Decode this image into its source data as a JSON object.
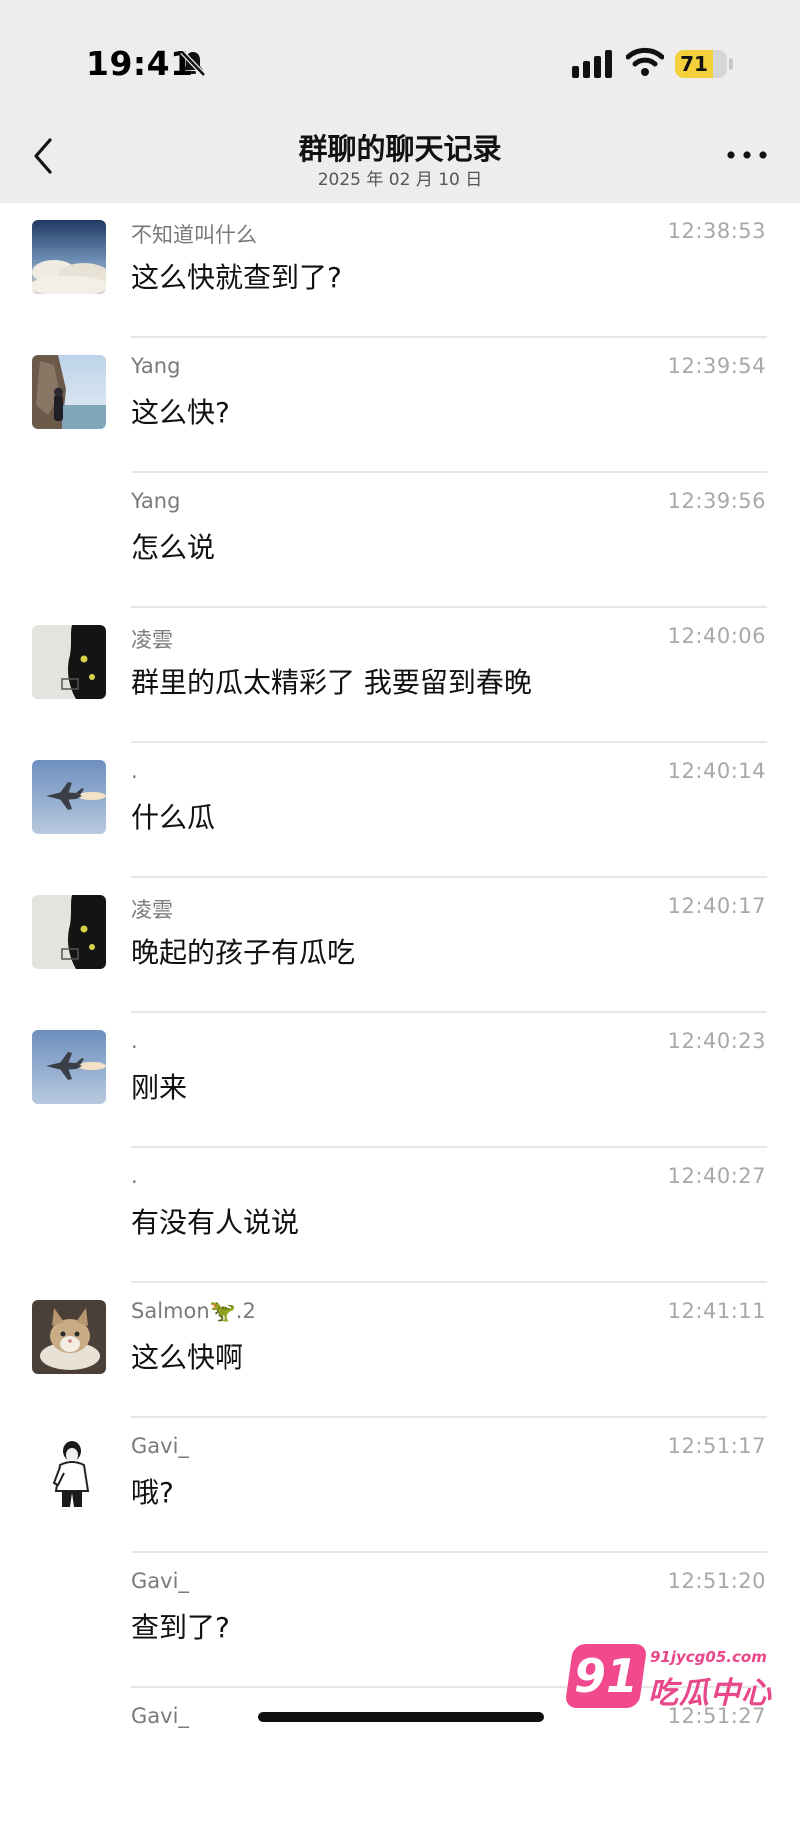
{
  "status_bar": {
    "time": "19:41",
    "battery": "71",
    "icons": [
      "bell-slash-icon",
      "signal-bars-icon",
      "wifi-icon",
      "battery-icon"
    ]
  },
  "nav": {
    "title": "群聊的聊天记录",
    "subtitle": "2025 年 02 月 10 日",
    "back_icon": "chevron-left-icon",
    "more_icon": "ellipsis-icon"
  },
  "messages": [
    {
      "sender": "不知道叫什么",
      "time": "12:38:53",
      "text": "这么快就查到了?",
      "avatar": "sky-clouds"
    },
    {
      "sender": "Yang",
      "time": "12:39:54",
      "text": "这么快?",
      "avatar": "seaside-rocks"
    },
    {
      "sender": "Yang",
      "time": "12:39:56",
      "text": "怎么说",
      "avatar": ""
    },
    {
      "sender": "凌雲",
      "time": "12:40:06",
      "text": "群里的瓜太精彩了 我要留到春晚",
      "avatar": "black-cat"
    },
    {
      "sender": ".",
      "time": "12:40:14",
      "text": "什么瓜",
      "avatar": "fighter-jet"
    },
    {
      "sender": "凌雲",
      "time": "12:40:17",
      "text": "晚起的孩子有瓜吃",
      "avatar": "black-cat"
    },
    {
      "sender": ".",
      "time": "12:40:23",
      "text": "刚来",
      "avatar": "fighter-jet"
    },
    {
      "sender": ".",
      "time": "12:40:27",
      "text": "有没有人说说",
      "avatar": ""
    },
    {
      "sender": "Salmon🦖.2",
      "time": "12:41:11",
      "text": "这么快啊",
      "avatar": "tabby-cat"
    },
    {
      "sender": "Gavi_",
      "time": "12:51:17",
      "text": "哦?",
      "avatar": "person-sketch"
    },
    {
      "sender": "Gavi_",
      "time": "12:51:20",
      "text": "查到了?",
      "avatar": ""
    },
    {
      "sender": "Gavi_",
      "time": "12:51:27",
      "text": "",
      "avatar": ""
    }
  ],
  "watermark": {
    "badge": "91",
    "url": "91jycg05.com",
    "name": "吃瓜中心",
    "color": "#e8478a"
  },
  "colors": {
    "header_bg": "#ededed",
    "time_text": "#a8a8a8",
    "sender_text": "#7a7a7a",
    "divider": "#e7e7e7"
  }
}
